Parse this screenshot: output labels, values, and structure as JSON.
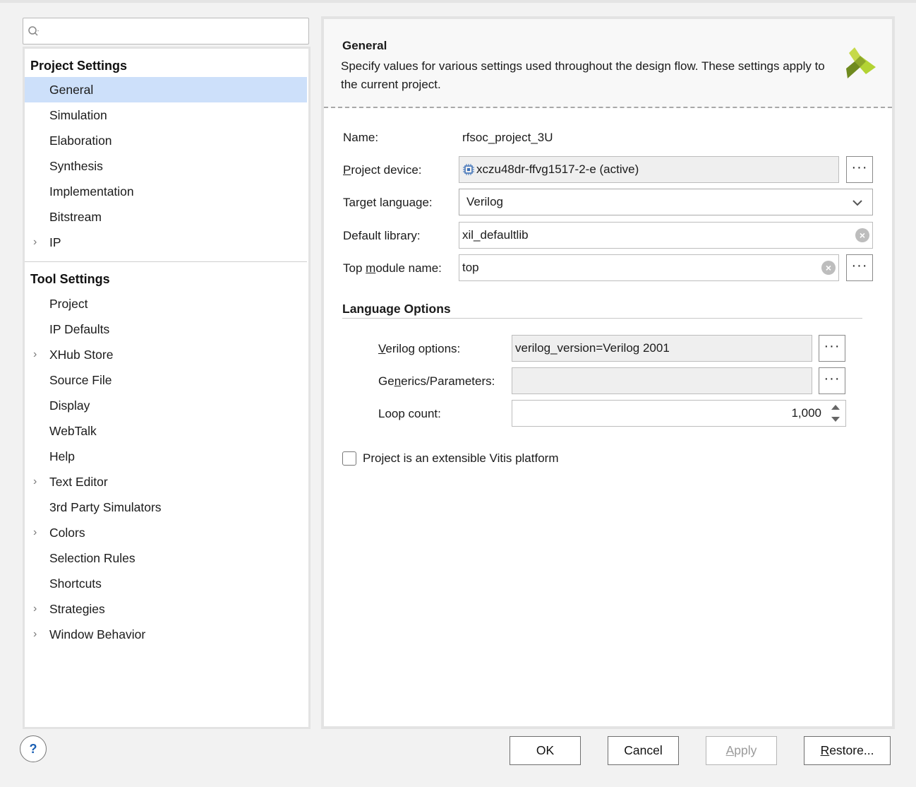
{
  "search": {
    "placeholder": ""
  },
  "sidebar": {
    "project_settings": {
      "title": "Project Settings",
      "items": [
        {
          "label": "General",
          "selected": true,
          "expandable": false
        },
        {
          "label": "Simulation",
          "expandable": false
        },
        {
          "label": "Elaboration",
          "expandable": false
        },
        {
          "label": "Synthesis",
          "expandable": false
        },
        {
          "label": "Implementation",
          "expandable": false
        },
        {
          "label": "Bitstream",
          "expandable": false
        },
        {
          "label": "IP",
          "expandable": true
        }
      ]
    },
    "tool_settings": {
      "title": "Tool Settings",
      "items": [
        {
          "label": "Project",
          "expandable": false
        },
        {
          "label": "IP Defaults",
          "expandable": false
        },
        {
          "label": "XHub Store",
          "expandable": true
        },
        {
          "label": "Source File",
          "expandable": false
        },
        {
          "label": "Display",
          "expandable": false
        },
        {
          "label": "WebTalk",
          "expandable": false
        },
        {
          "label": "Help",
          "expandable": false
        },
        {
          "label": "Text Editor",
          "expandable": true
        },
        {
          "label": "3rd Party Simulators",
          "expandable": false
        },
        {
          "label": "Colors",
          "expandable": true
        },
        {
          "label": "Selection Rules",
          "expandable": false
        },
        {
          "label": "Shortcuts",
          "expandable": false
        },
        {
          "label": "Strategies",
          "expandable": true
        },
        {
          "label": "Window Behavior",
          "expandable": true
        }
      ]
    }
  },
  "panel": {
    "title": "General",
    "description": "Specify values for various settings used throughout the design flow. These settings apply to the current project.",
    "logo_icon": "xilinx-logo-icon",
    "name_label": "Name:",
    "name_value": "rfsoc_project_3U",
    "device_label_pre": "",
    "device_label_u": "P",
    "device_label_post": "roject device:",
    "device_value": "xczu48dr-ffvg1517-2-e (active)",
    "language_label": "Target language:",
    "language_value": "Verilog",
    "library_label": "Default library:",
    "library_value": "xil_defaultlib",
    "top_label_pre": "Top ",
    "top_label_u": "m",
    "top_label_post": "odule name:",
    "top_value": "top",
    "language_options": {
      "title": "Language Options",
      "verilog_label_pre": "",
      "verilog_label_u": "V",
      "verilog_label_post": "erilog options:",
      "verilog_value": "verilog_version=Verilog 2001",
      "generics_label_pre": "Ge",
      "generics_label_u": "n",
      "generics_label_post": "erics/Parameters:",
      "generics_value": "",
      "loop_label": "Loop count:",
      "loop_value": "1,000"
    },
    "vitis_checkbox_label": "Project is an extensible Vitis platform",
    "vitis_checked": false,
    "more_button_label": "···"
  },
  "footer": {
    "help_label": "?",
    "ok_label": "OK",
    "cancel_label": "Cancel",
    "apply_pre": "",
    "apply_u": "A",
    "apply_post": "pply",
    "restore_pre": "",
    "restore_u": "R",
    "restore_post": "estore..."
  },
  "colors": {
    "selection": "#cde0fa",
    "logo_green_light": "#b3d334",
    "logo_green_dark": "#6f8a1f"
  }
}
